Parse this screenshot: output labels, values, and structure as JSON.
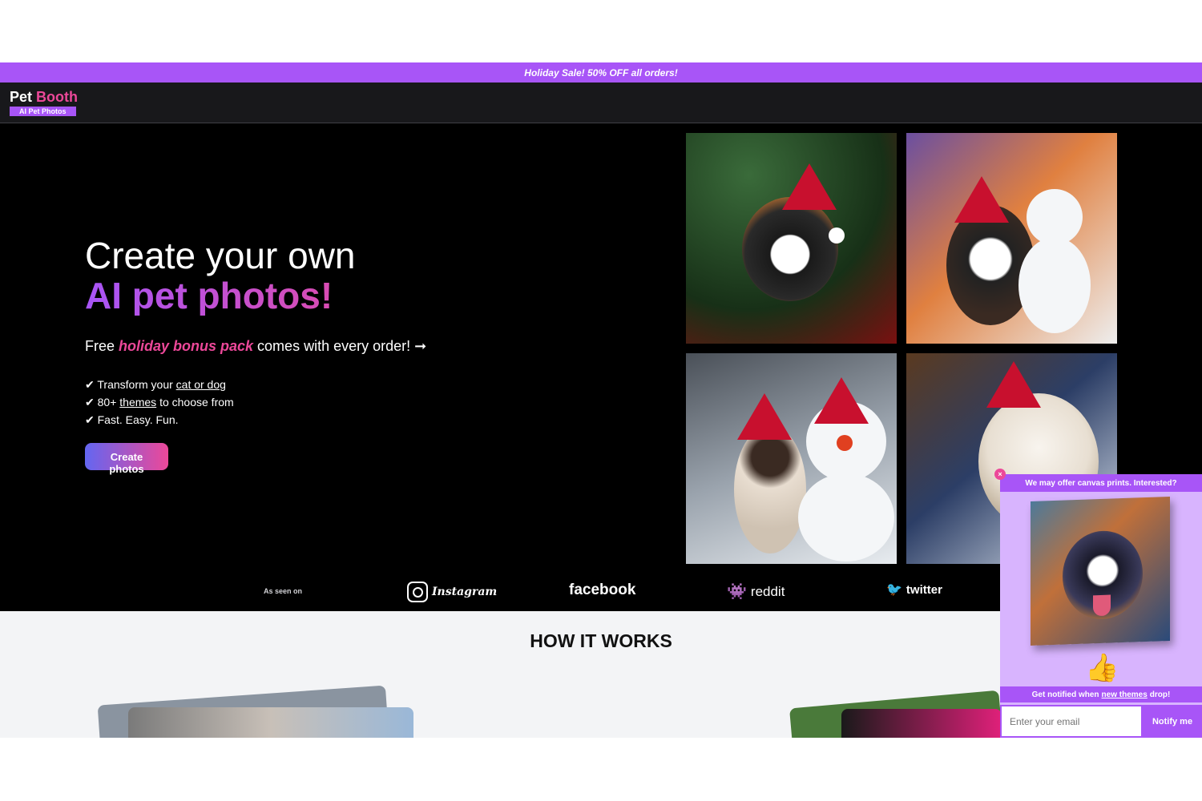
{
  "promo": {
    "text": "Holiday Sale! 50% OFF all orders!"
  },
  "brand": {
    "name_part1": "Pet",
    "name_part2": "Booth",
    "tagline": "AI Pet Photos"
  },
  "hero": {
    "title_line1": "Create your own",
    "title_line2": "AI pet photos!",
    "sub_prefix": "Free ",
    "sub_highlight": "holiday bonus pack",
    "sub_suffix": " comes with every order! ➞",
    "features": [
      {
        "check": "✔",
        "before": "Transform your ",
        "link": "cat or dog",
        "after": ""
      },
      {
        "check": "✔",
        "before": "80+ ",
        "link": "themes",
        "after": " to choose from"
      },
      {
        "check": "✔",
        "before": "Fast. Easy. Fun.",
        "link": "",
        "after": ""
      }
    ],
    "cta_label": "Create photos"
  },
  "gallery": {
    "tiles": [
      "dog-santa-hat-tree",
      "dog-snowman-painting",
      "cat-snowman",
      "cat-sled-painting"
    ]
  },
  "seen_on": {
    "label": "As seen on",
    "logos": [
      "Instagram",
      "facebook",
      "reddit",
      "twitter"
    ]
  },
  "how": {
    "title": "HOW IT WORKS"
  },
  "popup": {
    "close_label": "×",
    "header": "We may offer canvas prints. Interested?",
    "thumb_icon": "👍",
    "notify_before": "Get notified when",
    "notify_link": "new themes",
    "notify_after": "drop!",
    "email_placeholder": "Enter your email",
    "button_label": "Notify me"
  },
  "colors": {
    "accent": "#a855f7",
    "pink": "#ec4899",
    "nav_bg": "#18181b"
  }
}
